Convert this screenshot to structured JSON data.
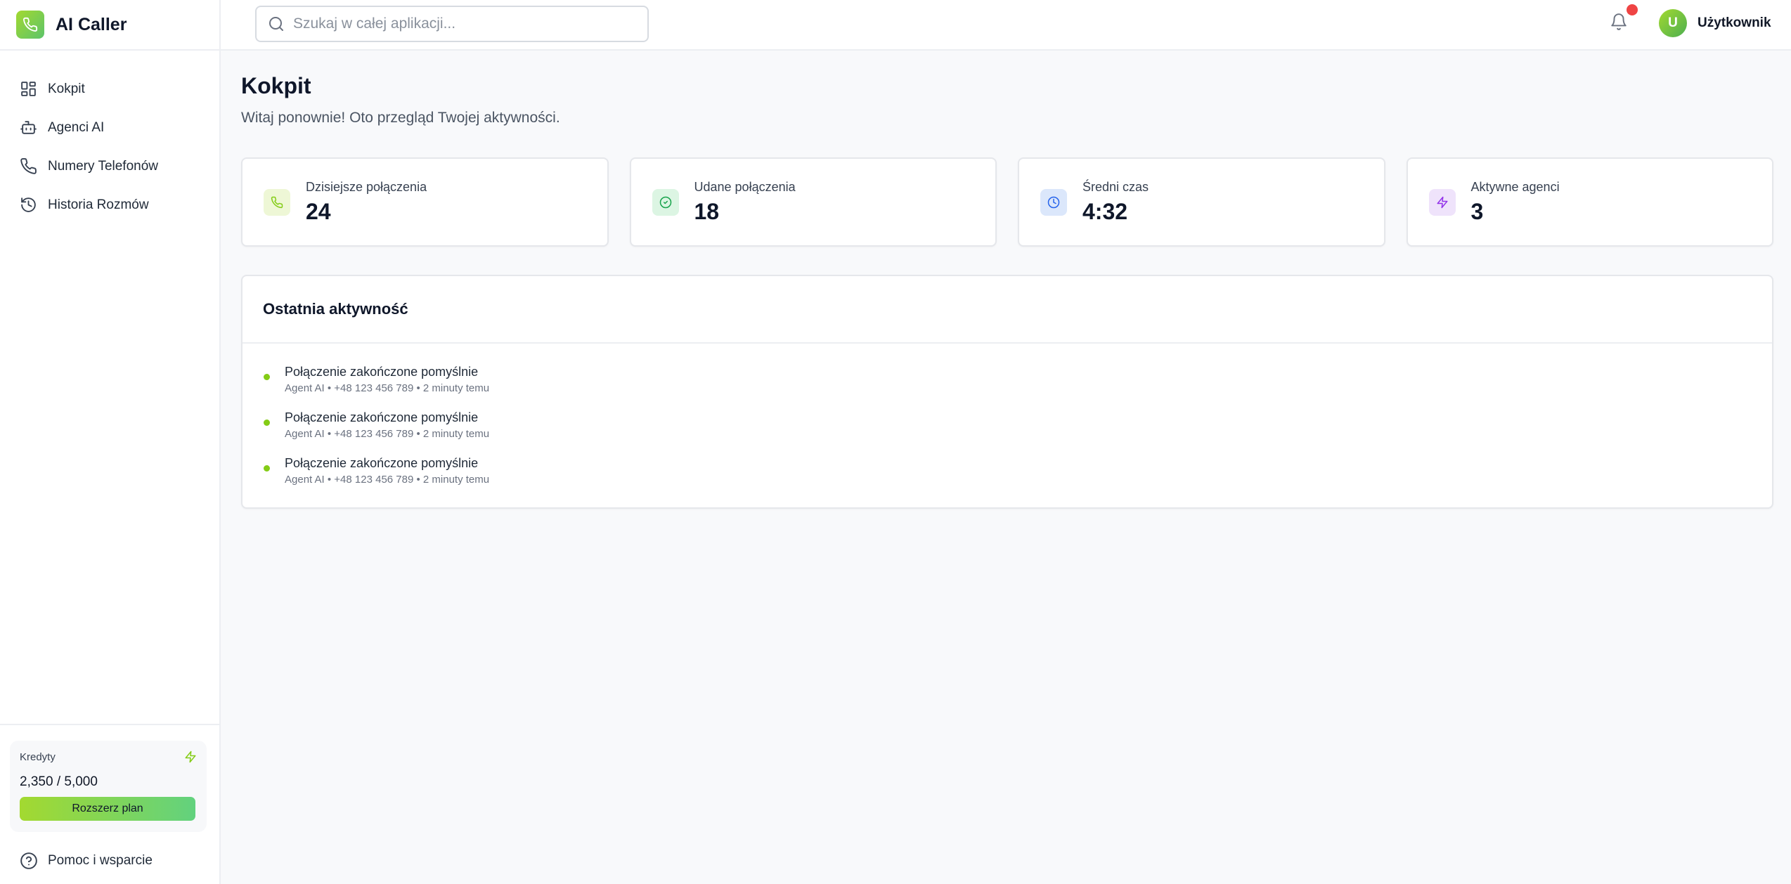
{
  "app": {
    "name": "AI Caller"
  },
  "sidebar": {
    "items": [
      {
        "label": "Kokpit",
        "icon": "dashboard-grid-icon"
      },
      {
        "label": "Agenci AI",
        "icon": "robot-icon"
      },
      {
        "label": "Numery Telefonów",
        "icon": "phone-icon"
      },
      {
        "label": "Historia Rozmów",
        "icon": "history-icon"
      }
    ],
    "credits": {
      "title": "Kredyty",
      "value": "2,350 / 5,000",
      "upgrade_label": "Rozszerz plan"
    },
    "help_label": "Pomoc i wsparcie"
  },
  "header": {
    "search_placeholder": "Szukaj w całej aplikacji...",
    "user": {
      "initial": "U",
      "name": "Użytkownik"
    }
  },
  "main": {
    "title": "Kokpit",
    "subtitle": "Witaj ponownie! Oto przegląd Twojej aktywności.",
    "stats": [
      {
        "label": "Dzisiejsze połączenia",
        "value": "24",
        "icon": "phone-icon",
        "color": "#84cc16",
        "bg": "#eef7d6"
      },
      {
        "label": "Udane połączenia",
        "value": "18",
        "icon": "check-circle-icon",
        "color": "#16a34a",
        "bg": "#dcf5e3"
      },
      {
        "label": "Średni czas",
        "value": "4:32",
        "icon": "clock-icon",
        "color": "#2563eb",
        "bg": "#dbe7fb"
      },
      {
        "label": "Aktywne agenci",
        "value": "3",
        "icon": "lightning-icon",
        "color": "#9333ea",
        "bg": "#efe3fb"
      }
    ],
    "activity": {
      "title": "Ostatnia aktywność",
      "items": [
        {
          "text": "Połączenie zakończone pomyślnie",
          "meta": "Agent AI • +48 123 456 789 • 2 minuty temu"
        },
        {
          "text": "Połączenie zakończone pomyślnie",
          "meta": "Agent AI • +48 123 456 789 • 2 minuty temu"
        },
        {
          "text": "Połączenie zakończone pomyślnie",
          "meta": "Agent AI • +48 123 456 789 • 2 minuty temu"
        }
      ]
    }
  },
  "colors": {
    "accent": "#84cc16",
    "notification": "#ef4444"
  }
}
